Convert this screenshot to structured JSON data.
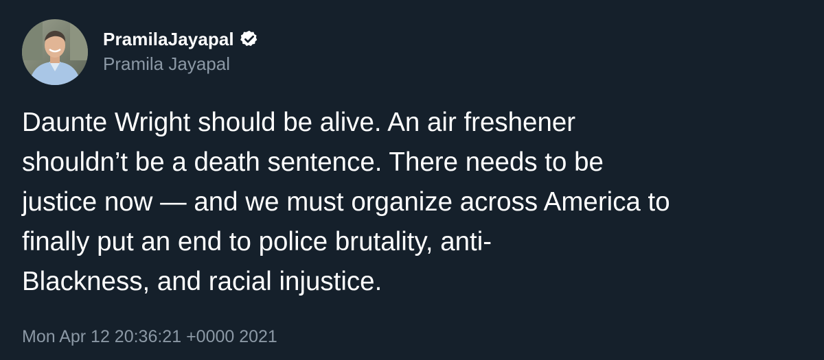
{
  "author": {
    "display_name": "PramilaJayapal",
    "handle": "Pramila Jayapal",
    "verified_icon": "verified-badge-icon"
  },
  "tweet": {
    "lines": [
      "Daunte Wright should be alive.  An air freshener",
      "shouldn’t be a death sentence. There needs to be",
      "justice now — and we must organize across America to",
      "finally put an end to police brutality, anti-",
      "Blackness, and racial injustice."
    ],
    "timestamp": "Mon Apr 12 20:36:21 +0000 2021"
  },
  "colors": {
    "background": "#15202b",
    "primary_text": "#ffffff",
    "secondary_text": "#8b98a5"
  }
}
